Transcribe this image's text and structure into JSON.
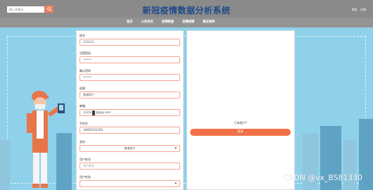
{
  "header": {
    "search_placeholder": "输入关键词",
    "site_title": "新冠疫情数据分析系统",
    "login_link": "登录",
    "register_link": "注册"
  },
  "nav": {
    "items": [
      "首页",
      "公告资讯",
      "疫情数据",
      "疫情病情",
      "确诊病例"
    ]
  },
  "form": {
    "account_label": "账号",
    "account_value": "123123",
    "password_label": "设置密码",
    "password_value": "•••••",
    "confirm_label": "确认密码",
    "confirm_value": "•••••",
    "role_label": "权限:",
    "role_value": "普通用户",
    "email_label": "邮箱",
    "email_value_before": "12312",
    "email_value_after": "3@qq.com",
    "phone_label": "手机号",
    "phone_value": "18665592206",
    "identity_label": "身份",
    "identity_value": "普通用户",
    "username_label": "用户姓名",
    "username_placeholder": "用户姓名",
    "gender_label": "用户性别"
  },
  "right_panel": {
    "have_account_text": "已有账户?",
    "login_button": "登录"
  },
  "watermark": "CSDN @vx_BS81330",
  "icons": {
    "search": "search-icon",
    "dropdown": "chevron-down-icon"
  },
  "colors": {
    "accent": "#f07047",
    "title": "#1e4a8a",
    "background_sky": "#8fd1ea"
  }
}
